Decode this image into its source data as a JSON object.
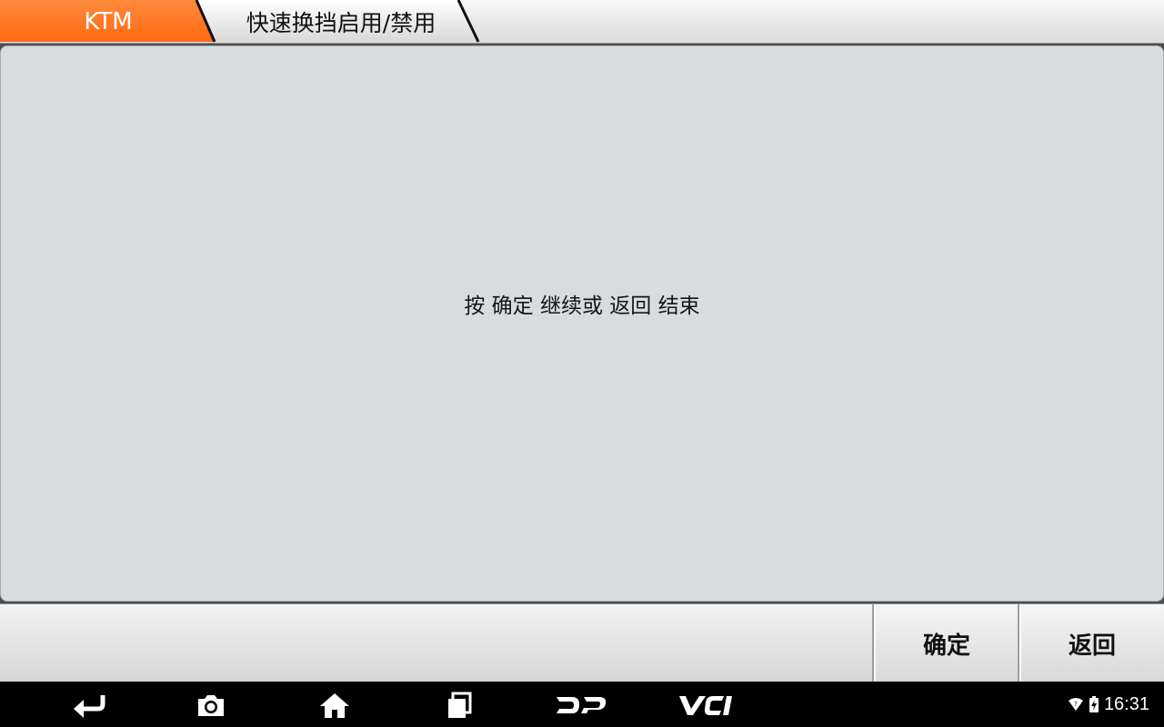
{
  "breadcrumb": {
    "brand": "KTM",
    "page_title": "快速换挡启用/禁用"
  },
  "main": {
    "message": "按 确定 继续或 返回 结束"
  },
  "actions": {
    "ok_label": "确定",
    "back_label": "返回"
  },
  "navbar": {
    "icons": [
      "back-icon",
      "camera-icon",
      "home-icon",
      "recent-apps-icon",
      "dp-logo-icon",
      "vci-icon"
    ],
    "time": "16:31"
  },
  "colors": {
    "accent": "#ff6a13",
    "panel": "#d8dcdf"
  }
}
